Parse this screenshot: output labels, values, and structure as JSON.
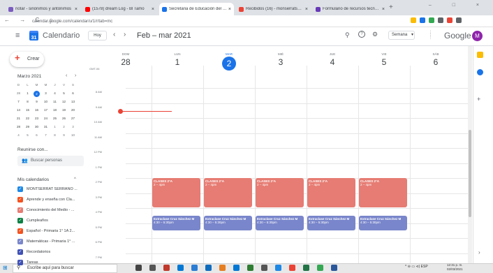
{
  "browser": {
    "tabs": [
      {
        "label": "notar - sinónimos y antónimos",
        "color": "#7b5cc0",
        "active": false
      },
      {
        "label": "(1578) dream Log - Bl Tamo",
        "color": "#ff0000",
        "active": false
      },
      {
        "label": "Secretaria de Educación del Esta",
        "color": "#1a73e8",
        "active": true
      },
      {
        "label": "Recibidos (16) - monserratsanc",
        "color": "#ea4335",
        "active": false
      },
      {
        "label": "Formulario de recursos tecnológ",
        "color": "#673ab7",
        "active": false
      }
    ],
    "new_tab": "+",
    "window_controls": "– □ ×",
    "nav_icons": "← → C ⌂",
    "url": "calendar.google.com/calendar/u/1/r/tab=mc",
    "extensions": [
      "#fbbc04",
      "#1a73e8",
      "#34a853",
      "#5f6368",
      "#ea4335",
      "#5f6368"
    ]
  },
  "header": {
    "menu_icon": "≡",
    "logo_text": "31",
    "title": "Calendario",
    "today": "Hoy",
    "prev": "‹",
    "next": "›",
    "date_range": "Feb – mar 2021",
    "search_icon": "⚲",
    "help_icon": "?",
    "settings_icon": "⚙",
    "view": "Semana",
    "view_caret": "▾",
    "apps_icon": "⋮⋮⋮",
    "google": "Google",
    "avatar": "M"
  },
  "sidebar": {
    "create": "Crear",
    "create_plus": "+",
    "mini_cal": {
      "title": "Marzo 2021",
      "prev": "‹",
      "next": "›",
      "weekdays": [
        "D",
        "L",
        "M",
        "M",
        "J",
        "V",
        "S"
      ],
      "weeks": [
        [
          "28",
          "1",
          "2",
          "3",
          "4",
          "5",
          "6"
        ],
        [
          "7",
          "8",
          "9",
          "10",
          "11",
          "12",
          "13"
        ],
        [
          "14",
          "15",
          "16",
          "17",
          "18",
          "19",
          "20"
        ],
        [
          "21",
          "22",
          "23",
          "24",
          "25",
          "26",
          "27"
        ],
        [
          "28",
          "29",
          "30",
          "31",
          "1",
          "2",
          "3"
        ],
        [
          "4",
          "5",
          "6",
          "7",
          "8",
          "9",
          "10"
        ]
      ],
      "selected": "2"
    },
    "meet_title": "Reunirse con...",
    "search_people": "Buscar personas",
    "people_icon": "👥",
    "my_calendars": "Mis calendarios",
    "my_calendars_caret": "^",
    "calendars": [
      {
        "name": "MONTSERRAT SERRANO ...",
        "color": "#1e88e5"
      },
      {
        "name": "Aprende y enseña con Cla...",
        "color": "#f4511e"
      },
      {
        "name": "Conocimiento del Medio - ...",
        "color": "#e67c73"
      },
      {
        "name": "Cumpleaños",
        "color": "#0b8043"
      },
      {
        "name": "Español - Primaria 1° 1A 2...",
        "color": "#f4511e"
      },
      {
        "name": "Matemáticas - Primaria 1° ...",
        "color": "#7986cb"
      },
      {
        "name": "Recordatorios",
        "color": "#3f51b5"
      },
      {
        "name": "Tareas",
        "color": "#3f51b5"
      }
    ]
  },
  "grid": {
    "gmt": "GMT-06",
    "days": [
      {
        "dow": "DOM",
        "num": "28",
        "today": false
      },
      {
        "dow": "LUN",
        "num": "1",
        "today": false
      },
      {
        "dow": "MAR",
        "num": "2",
        "today": true
      },
      {
        "dow": "MIÉ",
        "num": "3",
        "today": false
      },
      {
        "dow": "JUE",
        "num": "4",
        "today": false
      },
      {
        "dow": "VIE",
        "num": "5",
        "today": false
      },
      {
        "dow": "SÁB",
        "num": "6",
        "today": false
      }
    ],
    "hours": [
      "8 AM",
      "9 AM",
      "10 AM",
      "11 AM",
      "12 PM",
      "1 PM",
      "2 PM",
      "3 PM",
      "4 PM",
      "5 PM",
      "6 PM",
      "7 PM"
    ],
    "events": [
      {
        "day": 1,
        "title": "CLASES 2°A",
        "time": "2 – 4pm",
        "color": "#e67c73",
        "kind": "clases"
      },
      {
        "day": 2,
        "title": "CLASES 2°A",
        "time": "2 – 4pm",
        "color": "#e67c73",
        "kind": "clases"
      },
      {
        "day": 3,
        "title": "CLASES 2°A",
        "time": "2 – 4pm",
        "color": "#e67c73",
        "kind": "clases"
      },
      {
        "day": 4,
        "title": "CLASES 2°A",
        "time": "2 – 4pm",
        "color": "#e67c73",
        "kind": "clases"
      },
      {
        "day": 5,
        "title": "CLASES 2°A",
        "time": "2 – 4pm",
        "color": "#e67c73",
        "kind": "clases"
      },
      {
        "day": 1,
        "title": "Extraclase Cruz Sánchez M",
        "time": "4:30 – 5:30pm",
        "color": "#7986cb",
        "kind": "extra"
      },
      {
        "day": 2,
        "title": "Extraclase Cruz Sánchez M",
        "time": "4:30 – 5:30pm",
        "color": "#7986cb",
        "kind": "extra"
      },
      {
        "day": 3,
        "title": "Extraclase Cruz Sánchez M",
        "time": "4:30 – 5:30pm",
        "color": "#7986cb",
        "kind": "extra"
      },
      {
        "day": 4,
        "title": "Extraclase Cruz Sánchez M",
        "time": "4:30 – 5:30pm",
        "color": "#7986cb",
        "kind": "extra"
      },
      {
        "day": 5,
        "title": "Extraclase Cruz Sánchez M",
        "time": "4:30 – 5:30pm",
        "color": "#7986cb",
        "kind": "extra"
      }
    ]
  },
  "side_panel": {
    "colors": [
      "#fbbc04",
      "#1a73e8"
    ],
    "add": "+",
    "expand": "›"
  },
  "taskbar": {
    "start": "⊞",
    "search": "Escribe aquí para buscar",
    "search_icon": "⚲",
    "apps": [
      "#444",
      "#555",
      "#c0392b",
      "#0078d4",
      "#2b7cd3",
      "#0f6cbd",
      "#e67e22",
      "#0078d4",
      "#2e7d32",
      "#555",
      "#1e88e5",
      "#ea4335",
      "#217346",
      "#34a853",
      "#2b579a"
    ],
    "tray": "^ ⊖ ▭ ⊲) ESP",
    "time": "12:31 p. m.",
    "date": "02/03/2021"
  }
}
